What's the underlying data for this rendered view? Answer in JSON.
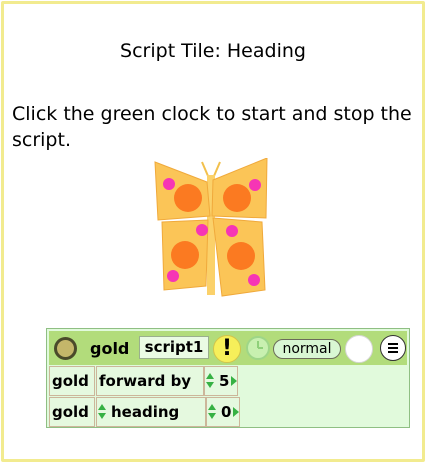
{
  "page": {
    "title": "Script Tile: Heading",
    "instructions": "Click the green clock to start and stop the script."
  },
  "script": {
    "object_name": "gold",
    "script_name": "script1",
    "alert_label": "!",
    "status": "normal",
    "rows": [
      {
        "object": "gold",
        "command": "forward by",
        "value": "5"
      },
      {
        "object": "gold",
        "command": "heading",
        "value": "0"
      }
    ]
  },
  "colors": {
    "frame_border": "#f2eb8f",
    "script_header": "#b2dc7b",
    "script_body": "#e1fadc",
    "arrow_green": "#36b143",
    "butterfly_wing": "#fbc557",
    "butterfly_spot_orange": "#fb7a21",
    "butterfly_spot_pink": "#f635b5"
  },
  "icons": [
    "close-circle-icon",
    "alert-icon",
    "clock-icon",
    "menu-icon",
    "butterfly-image"
  ]
}
